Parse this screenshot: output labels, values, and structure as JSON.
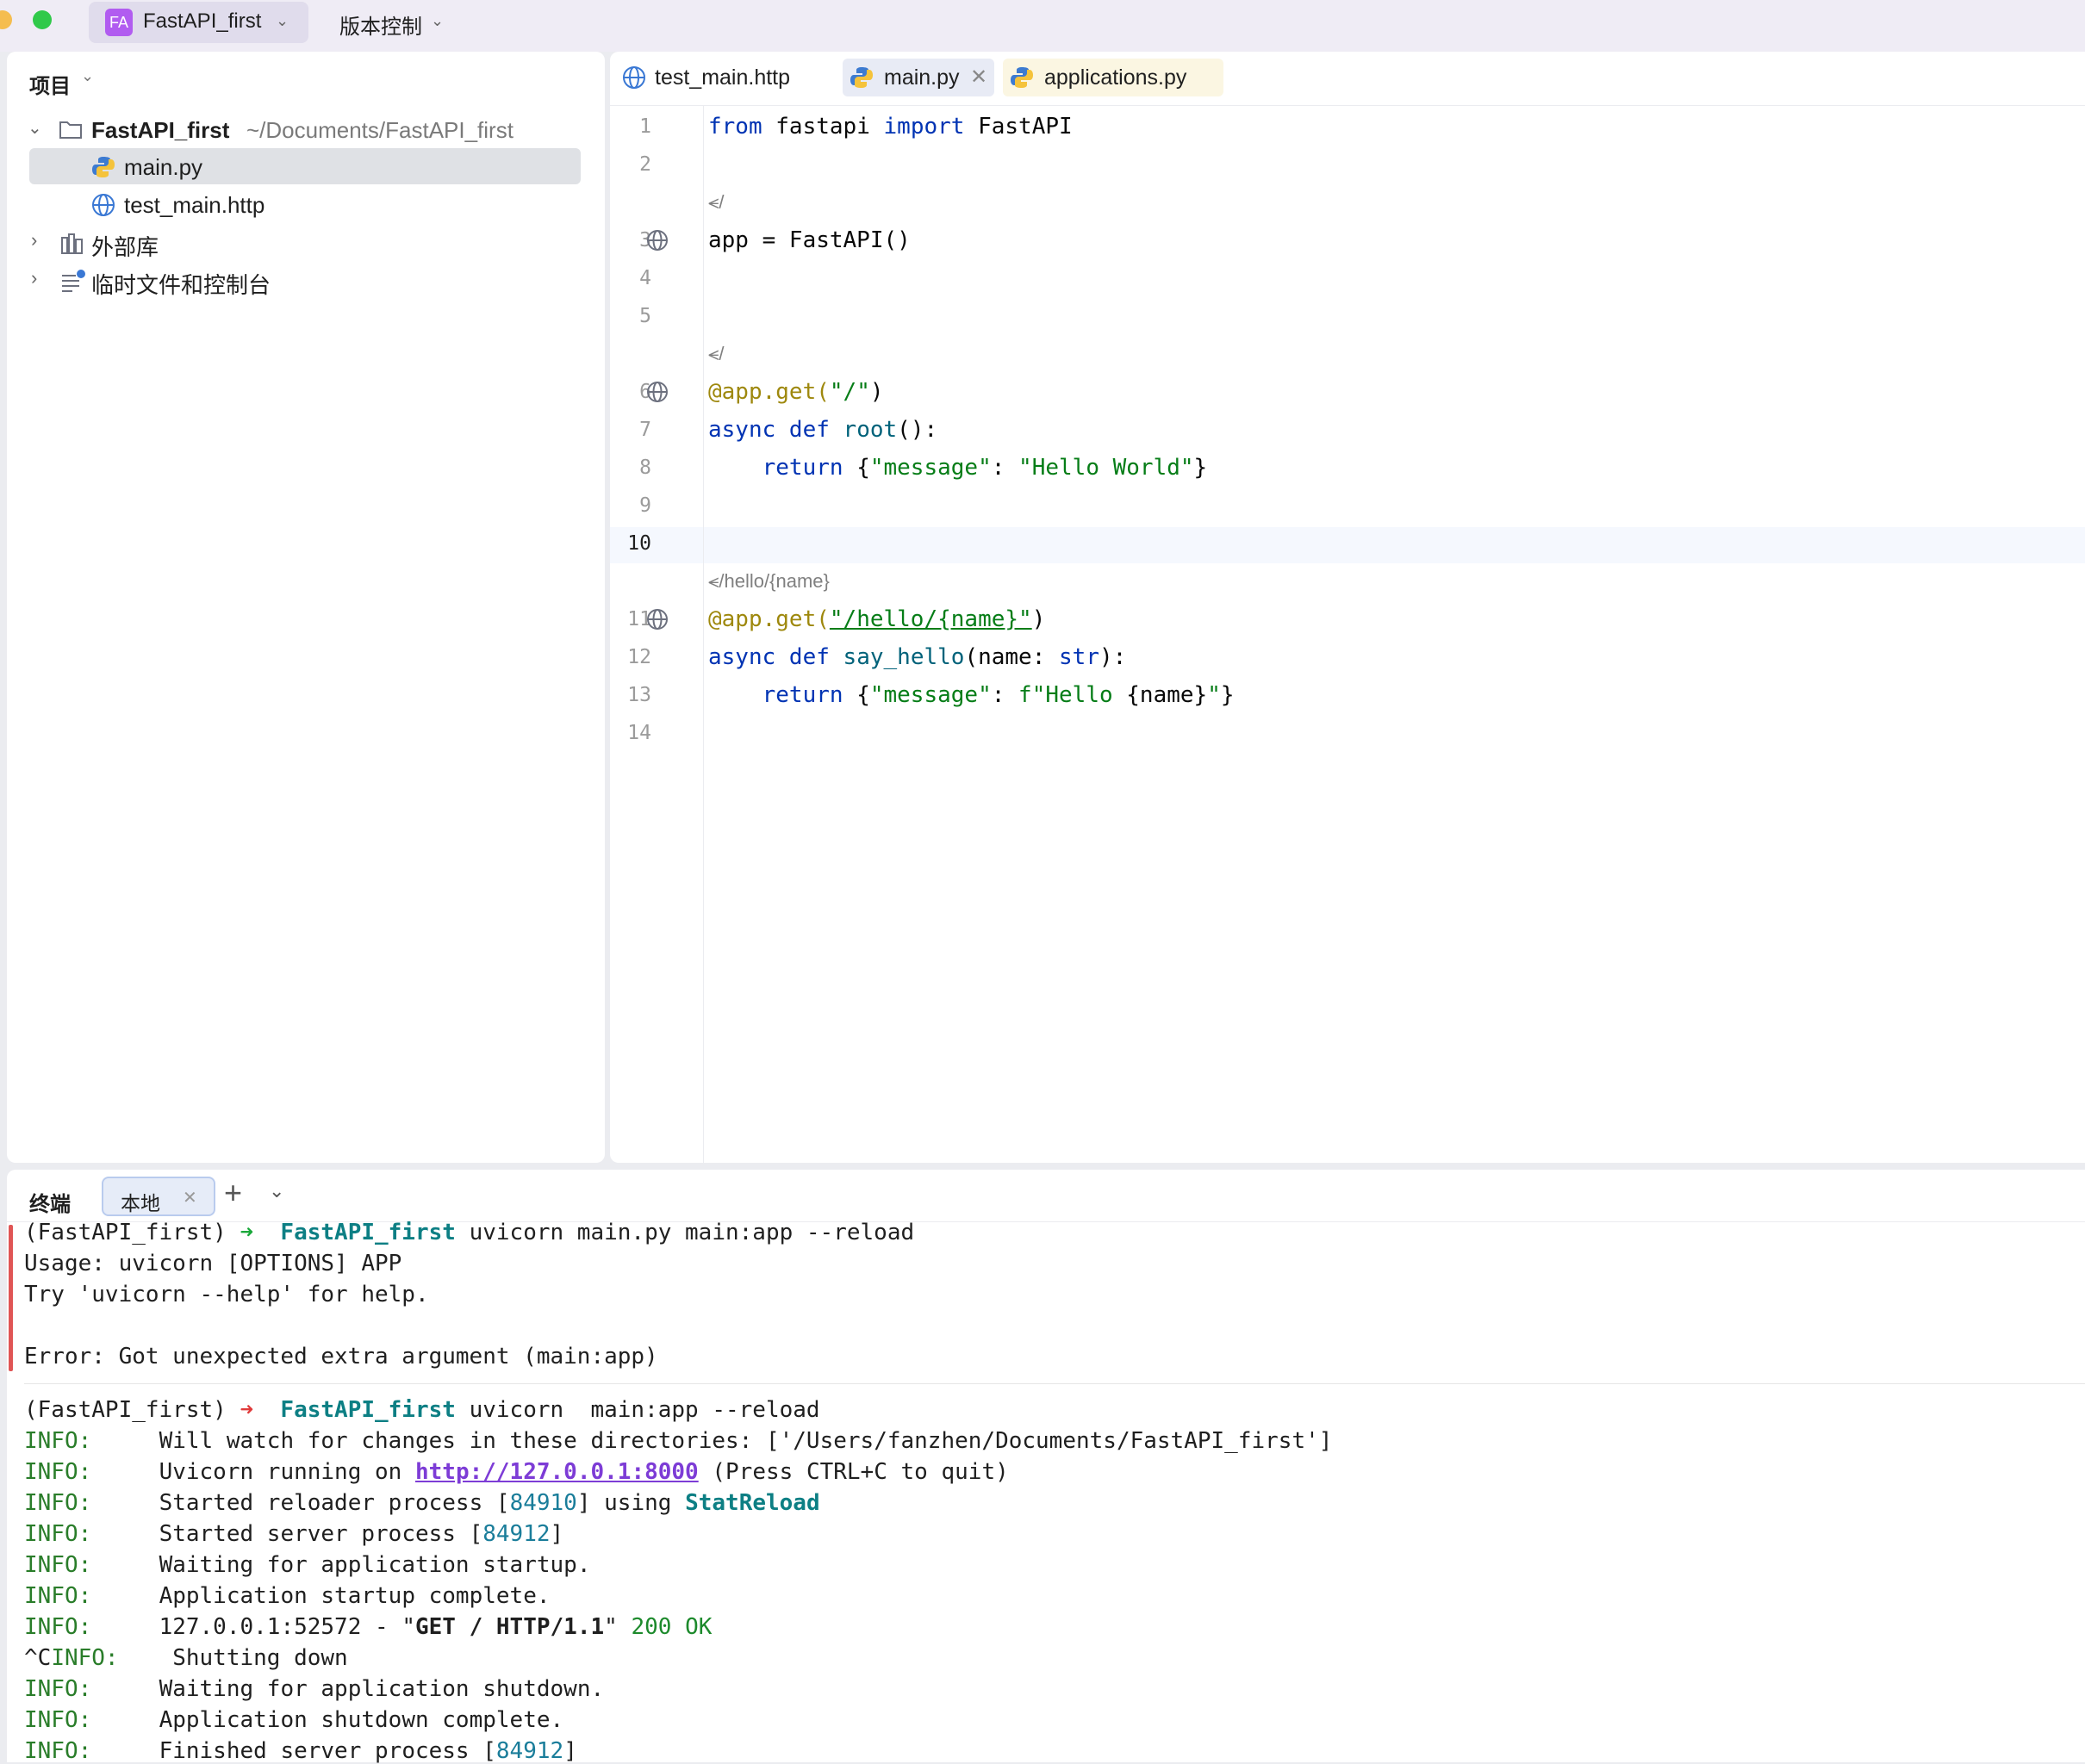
{
  "titlebar": {
    "project_badge": "FA",
    "project_name": "FastAPI_first",
    "vcs_label": "版本控制"
  },
  "project_panel": {
    "header": "项目",
    "root_name": "FastAPI_first",
    "root_path": "~/Documents/FastAPI_first",
    "files": [
      "main.py",
      "test_main.http"
    ],
    "external_libs": "外部库",
    "scratches": "临时文件和控制台"
  },
  "editor": {
    "tabs": [
      {
        "label": "test_main.http",
        "icon": "globe-icon"
      },
      {
        "label": "main.py",
        "icon": "python-icon",
        "active": true
      },
      {
        "label": "applications.py",
        "icon": "python-icon"
      }
    ],
    "hints": [
      "/",
      "/",
      "/hello/{name}"
    ],
    "line_numbers": [
      "1",
      "2",
      "3",
      "4",
      "5",
      "6",
      "7",
      "8",
      "9",
      "10",
      "11",
      "12",
      "13",
      "14"
    ],
    "lines": {
      "l1_kw1": "from",
      "l1_mod": " fastapi ",
      "l1_kw2": "import",
      "l1_name": " FastAPI",
      "l3": "app = FastAPI()",
      "l6_dec": "@app.get(",
      "l6_str": "\"/\"",
      "l6_end": ")",
      "l7_kw": "async def ",
      "l7_fn": "root",
      "l7_rest": "():",
      "l8_kw": "    return ",
      "l8_a": "{",
      "l8_key": "\"message\"",
      "l8_colon": ": ",
      "l8_val": "\"Hello World\"",
      "l8_b": "}",
      "l11_dec": "@app.get(",
      "l11_str": "\"/hello/{name}\"",
      "l11_end": ")",
      "l12_kw": "async def ",
      "l12_fn": "say_hello",
      "l12_rest": "(name: ",
      "l12_type": "str",
      "l12_end": "):",
      "l13_kw": "    return ",
      "l13_a": "{",
      "l13_key": "\"message\"",
      "l13_colon": ": ",
      "l13_val1": "f\"Hello ",
      "l13_var": "{name}",
      "l13_val2": "\"",
      "l13_b": "}"
    }
  },
  "terminal": {
    "title": "终端",
    "tab_label": "本地",
    "cmd1_env": "(FastAPI_first) ",
    "cmd1_arrow": "➜",
    "cmd1_dir": "FastAPI_first",
    "cmd1_cmd": " uvicorn main.py main:app --reload",
    "out1": "Usage: uvicorn [OPTIONS] APP",
    "out2": "Try 'uvicorn --help' for help.",
    "out3": "Error: Got unexpected extra argument (main:app)",
    "cmd2_env": "(FastAPI_first) ",
    "cmd2_arrow": "➜",
    "cmd2_dir": "FastAPI_first",
    "cmd2_cmd": " uvicorn  main:app --reload",
    "info": "INFO:",
    "log1": "Will watch for changes in these directories: ['/Users/fanzhen/Documents/FastAPI_first']",
    "log2_a": "Uvicorn running on ",
    "log2_link": "http://127.0.0.1:8000",
    "log2_b": " (Press CTRL+C to quit)",
    "log3_a": "Started reloader process [",
    "log3_pid": "84910",
    "log3_b": "] using ",
    "log3_c": "StatReload",
    "log4_a": "Started server process [",
    "log4_pid": "84912",
    "log4_b": "]",
    "log5": "Waiting for application startup.",
    "log6": "Application startup complete.",
    "log7_a": "127.0.0.1:52572 - \"",
    "log7_b": "GET / HTTP/1.1",
    "log7_c": "\" ",
    "log7_d": "200 OK",
    "log8_prefix": "^C",
    "log8": "Shutting down",
    "log9": "Waiting for application shutdown.",
    "log10": "Application shutdown complete.",
    "log11_a": "Finished server process [",
    "log11_pid": "84912",
    "log11_b": "]"
  },
  "colors": {
    "keyword": "#0033b3",
    "string": "#067d17",
    "decorator": "#9e880d",
    "function": "#00627a",
    "terminal_info": "#2a7d2a",
    "terminal_bold_teal": "#0d7f84",
    "error_bar": "#e05555"
  }
}
